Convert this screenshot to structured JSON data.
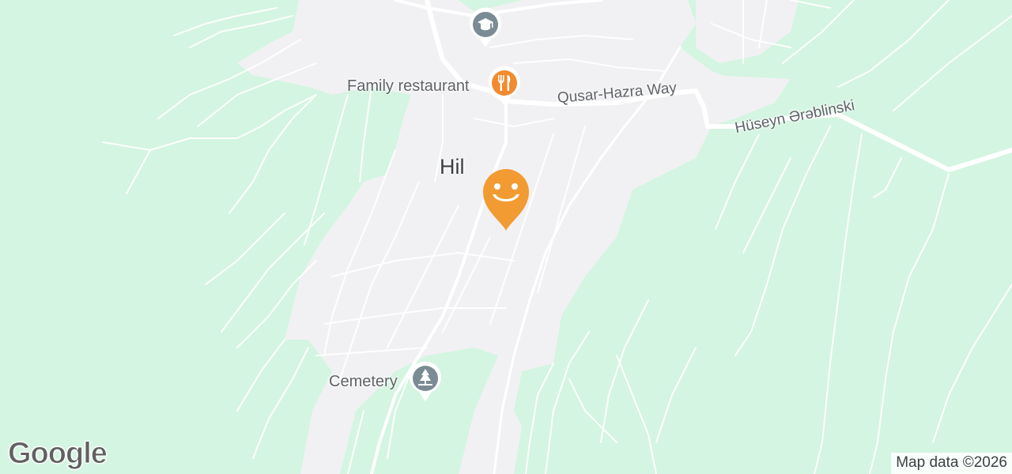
{
  "map": {
    "place_name": "Hil",
    "roads": [
      {
        "name": "Qusar-Hazra Way"
      },
      {
        "name": "Hüseyn Ərəblinski"
      }
    ],
    "pois": [
      {
        "name": "Family restaurant",
        "icon": "fork-knife-icon",
        "color": "#f28b30"
      },
      {
        "name": "Cemetery",
        "icon": "cemetery-tree-icon",
        "color": "#7b8b94"
      },
      {
        "name": "",
        "icon": "graduation-cap-icon",
        "color": "#7b8b94"
      }
    ],
    "current_location_icon": "smiley-face-icon",
    "current_location_color": "#f29b32",
    "attribution": "Map data ©2026",
    "logo": "Google",
    "colors": {
      "land": "#d4f5e1",
      "urban": "#f1f1f3",
      "road": "#ffffff",
      "label": "#5f6368"
    }
  }
}
